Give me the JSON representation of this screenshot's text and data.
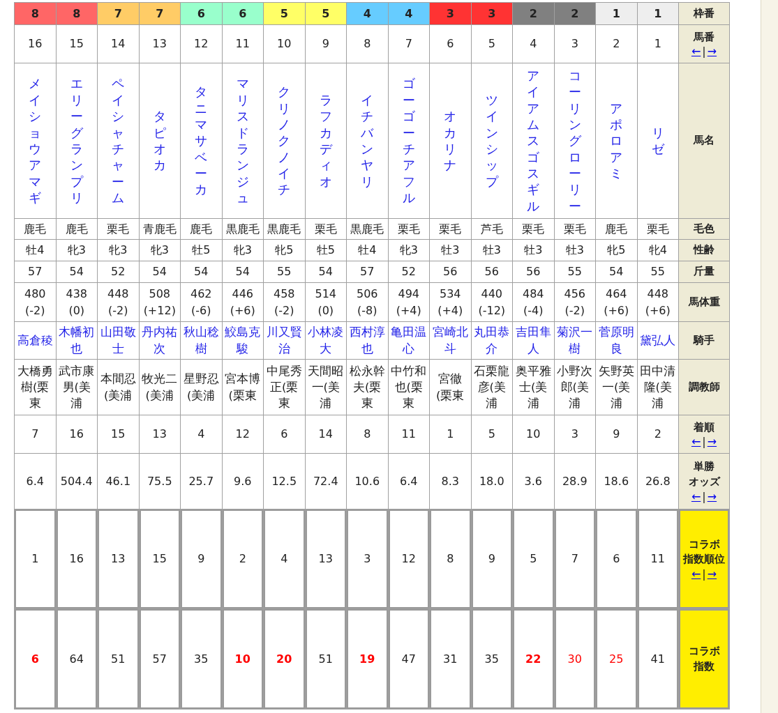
{
  "row_headers": [
    {
      "label_lines": [
        "枠番"
      ],
      "kind": "plain"
    },
    {
      "label_lines": [
        "馬番"
      ],
      "kind": "plain",
      "sort_links": {
        "left": "←",
        "separator": "|",
        "right": "→"
      }
    },
    {
      "label_lines": [
        "馬名"
      ],
      "kind": "plain"
    },
    {
      "label_lines": [
        "毛色"
      ],
      "kind": "plain"
    },
    {
      "label_lines": [
        "性齢"
      ],
      "kind": "plain"
    },
    {
      "label_lines": [
        "斤量"
      ],
      "kind": "plain"
    },
    {
      "label_lines": [
        "馬体重"
      ],
      "kind": "plain"
    },
    {
      "label_lines": [
        "騎手"
      ],
      "kind": "plain"
    },
    {
      "label_lines": [
        "調教師"
      ],
      "kind": "plain"
    },
    {
      "label_lines": [
        "着順"
      ],
      "kind": "plain",
      "sort_links": {
        "left": "←",
        "separator": "|",
        "right": "→"
      }
    },
    {
      "label_lines": [
        "単勝",
        "オッズ"
      ],
      "kind": "plain",
      "sort_links": {
        "left": "←",
        "separator": "|",
        "right": "→"
      }
    },
    {
      "label_lines": [
        "コラボ",
        "指数順位"
      ],
      "kind": "collab",
      "sort_links": {
        "left": "←",
        "separator": "|",
        "right": "→"
      }
    },
    {
      "label_lines": [
        "コラボ",
        "指数"
      ],
      "kind": "collab"
    }
  ],
  "horses": [
    {
      "frame": "8",
      "color": "#ff6666",
      "number": "16",
      "name": "メイショウアマギ",
      "coat": "鹿毛",
      "sex_age": "牡4",
      "weight": "57",
      "body_weight": "480",
      "body_change": "(-2)",
      "jockey": "高倉稜",
      "trainer": "大橋勇樹(栗東",
      "finish": "7",
      "odds": "6.4",
      "collab_rank": "1",
      "collab_index": "6",
      "kind": "strong"
    },
    {
      "frame": "8",
      "color": "#ff6666",
      "number": "15",
      "name": "エリーグランプリ",
      "coat": "鹿毛",
      "sex_age": "牝3",
      "weight": "54",
      "body_weight": "438",
      "body_change": "(0)",
      "jockey": "木幡初也",
      "trainer": "武市康男(美浦",
      "finish": "16",
      "odds": "504.4",
      "collab_rank": "16",
      "collab_index": "64",
      "kind": "none"
    },
    {
      "frame": "7",
      "color": "#ffcc66",
      "number": "14",
      "name": "ペイシャチャーム",
      "coat": "栗毛",
      "sex_age": "牝3",
      "weight": "52",
      "body_weight": "448",
      "body_change": "(-2)",
      "jockey": "山田敬士",
      "trainer": "本間忍(美浦",
      "finish": "15",
      "odds": "46.1",
      "collab_rank": "13",
      "collab_index": "51",
      "kind": "none"
    },
    {
      "frame": "7",
      "color": "#ffcc66",
      "number": "13",
      "name": "タピオカ",
      "coat": "青鹿毛",
      "sex_age": "牝3",
      "weight": "54",
      "body_weight": "508",
      "body_change": "(+12)",
      "jockey": "丹内祐次",
      "trainer": "牧光二(美浦",
      "finish": "13",
      "odds": "75.5",
      "collab_rank": "15",
      "collab_index": "57",
      "kind": "none"
    },
    {
      "frame": "6",
      "color": "#99ffcc",
      "number": "12",
      "name": "タニマサベーカ",
      "coat": "鹿毛",
      "sex_age": "牡5",
      "weight": "54",
      "body_weight": "462",
      "body_change": "(-6)",
      "jockey": "秋山稔樹",
      "trainer": "星野忍(美浦",
      "finish": "4",
      "odds": "25.7",
      "collab_rank": "9",
      "collab_index": "35",
      "kind": "none"
    },
    {
      "frame": "6",
      "color": "#99ffcc",
      "number": "11",
      "name": "マリスドランジュ",
      "coat": "黒鹿毛",
      "sex_age": "牝3",
      "weight": "54",
      "body_weight": "446",
      "body_change": "(+6)",
      "jockey": "鮫島克駿",
      "trainer": "宮本博(栗東",
      "finish": "12",
      "odds": "9.6",
      "collab_rank": "2",
      "collab_index": "10",
      "kind": "strong"
    },
    {
      "frame": "5",
      "color": "#ffff66",
      "number": "10",
      "name": "クリノクノイチ",
      "coat": "黒鹿毛",
      "sex_age": "牝5",
      "weight": "55",
      "body_weight": "458",
      "body_change": "(-2)",
      "jockey": "川又賢治",
      "trainer": "中尾秀正(栗東",
      "finish": "6",
      "odds": "12.5",
      "collab_rank": "4",
      "collab_index": "20",
      "kind": "strong"
    },
    {
      "frame": "5",
      "color": "#ffff66",
      "number": "9",
      "name": "ラフカディオ",
      "coat": "栗毛",
      "sex_age": "牡5",
      "weight": "54",
      "body_weight": "514",
      "body_change": "(0)",
      "jockey": "小林凌大",
      "trainer": "天間昭一(美浦",
      "finish": "14",
      "odds": "72.4",
      "collab_rank": "13",
      "collab_index": "51",
      "kind": "none"
    },
    {
      "frame": "4",
      "color": "#66ccff",
      "number": "8",
      "name": "イチバンヤリ",
      "coat": "黒鹿毛",
      "sex_age": "牡4",
      "weight": "57",
      "body_weight": "506",
      "body_change": "(-8)",
      "jockey": "西村淳也",
      "trainer": "松永幹夫(栗東",
      "finish": "8",
      "odds": "10.6",
      "collab_rank": "3",
      "collab_index": "19",
      "kind": "strong"
    },
    {
      "frame": "4",
      "color": "#66ccff",
      "number": "7",
      "name": "ゴーゴーチアフル",
      "coat": "栗毛",
      "sex_age": "牝3",
      "weight": "52",
      "body_weight": "494",
      "body_change": "(+4)",
      "jockey": "亀田温心",
      "trainer": "中竹和也(栗東",
      "finish": "11",
      "odds": "6.4",
      "collab_rank": "12",
      "collab_index": "47",
      "kind": "none"
    },
    {
      "frame": "3",
      "color": "#ff3333",
      "number": "6",
      "name": "オカリナ",
      "coat": "栗毛",
      "sex_age": "牡3",
      "weight": "56",
      "body_weight": "534",
      "body_change": "(+4)",
      "jockey": "宮崎北斗",
      "trainer": "宮徹(栗東",
      "finish": "1",
      "odds": "8.3",
      "collab_rank": "8",
      "collab_index": "31",
      "kind": "none"
    },
    {
      "frame": "3",
      "color": "#ff3333",
      "number": "5",
      "name": "ツインシップ",
      "coat": "芦毛",
      "sex_age": "牡3",
      "weight": "56",
      "body_weight": "440",
      "body_change": "(-12)",
      "jockey": "丸田恭介",
      "trainer": "石栗龍彦(美浦",
      "finish": "5",
      "odds": "18.0",
      "collab_rank": "9",
      "collab_index": "35",
      "kind": "none"
    },
    {
      "frame": "2",
      "color": "#808080",
      "number": "4",
      "name": "アイアムスゴスギル",
      "coat": "栗毛",
      "sex_age": "牡3",
      "weight": "56",
      "body_weight": "484",
      "body_change": "(-4)",
      "jockey": "吉田隼人",
      "trainer": "奥平雅士(美浦",
      "finish": "10",
      "odds": "3.6",
      "collab_rank": "5",
      "collab_index": "22",
      "kind": "strong"
    },
    {
      "frame": "2",
      "color": "#808080",
      "number": "3",
      "name": "コーリングローリー",
      "coat": "栗毛",
      "sex_age": "牡3",
      "weight": "55",
      "body_weight": "456",
      "body_change": "(-2)",
      "jockey": "菊沢一樹",
      "trainer": "小野次郎(美浦",
      "finish": "3",
      "odds": "28.9",
      "collab_rank": "7",
      "collab_index": "30",
      "kind": "weak"
    },
    {
      "frame": "1",
      "color": "#eeeeee",
      "number": "2",
      "name": "アポロアミ",
      "coat": "鹿毛",
      "sex_age": "牝5",
      "weight": "54",
      "body_weight": "464",
      "body_change": "(+6)",
      "jockey": "菅原明良",
      "trainer": "矢野英一(美浦",
      "finish": "9",
      "odds": "18.6",
      "collab_rank": "6",
      "collab_index": "25",
      "kind": "weak"
    },
    {
      "frame": "1",
      "color": "#eeeeee",
      "number": "1",
      "name": "リゼ",
      "coat": "栗毛",
      "sex_age": "牝4",
      "weight": "55",
      "body_weight": "448",
      "body_change": "(+6)",
      "jockey": "黛弘人",
      "trainer": "田中清隆(美浦",
      "finish": "2",
      "odds": "26.8",
      "collab_rank": "11",
      "collab_index": "41",
      "kind": "none"
    }
  ]
}
